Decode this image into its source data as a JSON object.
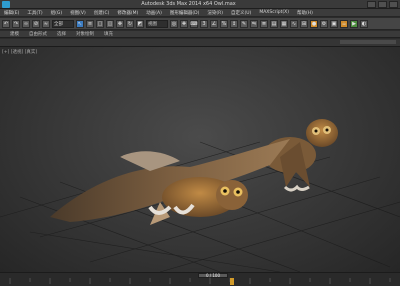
{
  "window": {
    "title": "Autodesk 3ds Max 2014 x64      Owl.max"
  },
  "menu": {
    "items": [
      "编辑(E)",
      "工具(T)",
      "组(G)",
      "视图(V)",
      "创建(C)",
      "修改器(M)",
      "动画(A)",
      "图形编辑器(D)",
      "渲染(R)",
      "自定义(U)",
      "MAXScript(X)",
      "帮助(H)"
    ]
  },
  "toolbar": {
    "selection_filter": "全部",
    "view_ref": "视图"
  },
  "ribbon": {
    "tabs": [
      "建模",
      "自由形式",
      "选择",
      "对象绘制",
      "填充"
    ]
  },
  "viewport": {
    "label": "[+] [透视] [真实]"
  },
  "timeline": {
    "slider_label": "0 / 100"
  },
  "colors": {
    "accent": "#2e9ccf",
    "viewport_bg": "#3a3a3a",
    "timeline_active": "#d29b2a"
  }
}
